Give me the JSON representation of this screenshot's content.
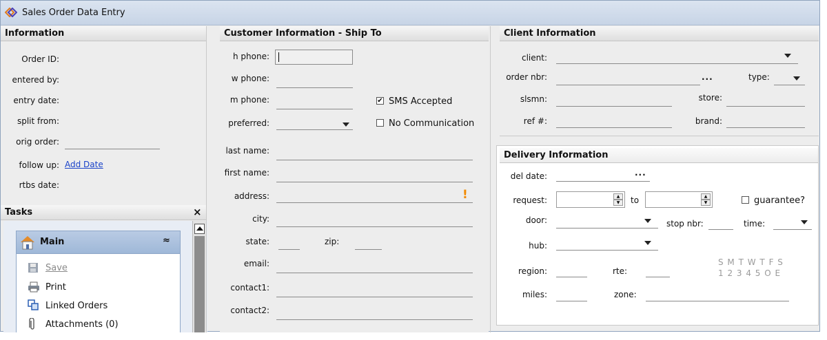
{
  "window": {
    "title": "Sales Order Data Entry"
  },
  "info": {
    "header": "Information",
    "order_id": "Order ID:",
    "entered_by": "entered by:",
    "entry_date": "entry date:",
    "split_from": "split from:",
    "orig_order": "orig order:",
    "follow_up": "follow up:",
    "add_date": "Add Date",
    "rtbs_date": "rtbs date:"
  },
  "tasks": {
    "header": "Tasks",
    "close": "×",
    "main": "Main",
    "collapse": "≈",
    "items": [
      "Save",
      "Print",
      "Linked Orders",
      "Attachments (0)"
    ]
  },
  "customer": {
    "header": "Customer Information - Ship To",
    "h_phone": "h phone:",
    "w_phone": "w phone:",
    "m_phone": "m phone:",
    "preferred": "preferred:",
    "sms": "SMS Accepted",
    "no_comm": "No Communication",
    "last_name": "last name:",
    "first_name": "first name:",
    "address": "address:",
    "city": "city:",
    "state": "state:",
    "zip": "zip:",
    "email": "email:",
    "contact1": "contact1:",
    "contact2": "contact2:",
    "warn": "!"
  },
  "client": {
    "header": "Client Information",
    "client": "client:",
    "order_nbr": "order nbr:",
    "dots": "...",
    "type": "type:",
    "slsmn": "slsmn:",
    "store": "store:",
    "ref": "ref #:",
    "brand": "brand:"
  },
  "delivery": {
    "header": "Delivery Information",
    "del_date": "del date:",
    "dots": "...",
    "request": "request:",
    "to": "to",
    "guarantee": "guarantee?",
    "door": "door:",
    "stop_nbr": "stop nbr:",
    "time": "time:",
    "hub": "hub:",
    "region": "region:",
    "rte": "rte:",
    "miles": "miles:",
    "zone": "zone:",
    "days": "S M T W T F S",
    "nums": "1 2 3 4 5 O E"
  }
}
